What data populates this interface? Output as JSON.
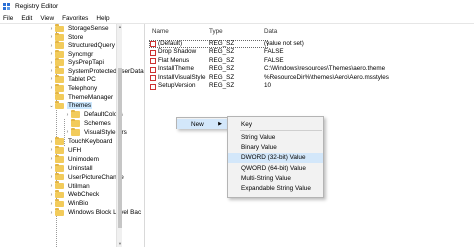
{
  "window": {
    "title": "Registry Editor"
  },
  "menu": [
    "File",
    "Edit",
    "View",
    "Favorites",
    "Help"
  ],
  "tree": {
    "items": [
      {
        "label": "StorageSense",
        "expandable": true
      },
      {
        "label": "Store",
        "expandable": true
      },
      {
        "label": "StructuredQuery",
        "expandable": true
      },
      {
        "label": "Syncmgr",
        "expandable": true
      },
      {
        "label": "SysPrepTapi",
        "expandable": true
      },
      {
        "label": "SystemProtectedUserData",
        "expandable": true
      },
      {
        "label": "Tablet PC",
        "expandable": true
      },
      {
        "label": "Telephony",
        "expandable": true
      },
      {
        "label": "ThemeManager",
        "expandable": false
      },
      {
        "label": "Themes",
        "expandable": true,
        "expanded": true,
        "selected": true
      },
      {
        "label": "DefaultColors",
        "expandable": true,
        "child": true
      },
      {
        "label": "Schemes",
        "expandable": false,
        "child": true
      },
      {
        "label": "VisualStyleDirs",
        "expandable": true,
        "child": true
      },
      {
        "label": "TouchKeyboard",
        "expandable": true
      },
      {
        "label": "UFH",
        "expandable": true
      },
      {
        "label": "Unimodem",
        "expandable": true
      },
      {
        "label": "Uninstall",
        "expandable": true
      },
      {
        "label": "UserPictureChange",
        "expandable": true
      },
      {
        "label": "Utilman",
        "expandable": true
      },
      {
        "label": "WebCheck",
        "expandable": true
      },
      {
        "label": "WinBio",
        "expandable": true
      },
      {
        "label": "Windows Block Level Bac",
        "expandable": true
      }
    ]
  },
  "list": {
    "headers": {
      "name": "Name",
      "type": "Type",
      "data": "Data"
    },
    "rows": [
      {
        "name": "(Default)",
        "type": "REG_SZ",
        "data": "(value not set)",
        "icon": "string"
      },
      {
        "name": "Drop Shadow",
        "type": "REG_SZ",
        "data": "FALSE",
        "icon": "string"
      },
      {
        "name": "Flat Menus",
        "type": "REG_SZ",
        "data": "FALSE",
        "icon": "string"
      },
      {
        "name": "InstallTheme",
        "type": "REG_SZ",
        "data": "C:\\Windows\\resources\\Themes\\aero.theme",
        "icon": "string"
      },
      {
        "name": "InstallVisualStyle",
        "type": "REG_SZ",
        "data": "%ResourceDir%\\themes\\Aero\\Aero.msstyles",
        "icon": "string"
      },
      {
        "name": "SetupVersion",
        "type": "REG_SZ",
        "data": "10",
        "icon": "string"
      }
    ]
  },
  "context_menu": {
    "new_label": "New",
    "submenu": [
      "Key",
      "String Value",
      "Binary Value",
      "DWORD (32-bit) Value",
      "QWORD (64-bit) Value",
      "Multi-String Value",
      "Expandable String Value"
    ],
    "highlighted": "DWORD (32-bit) Value"
  }
}
